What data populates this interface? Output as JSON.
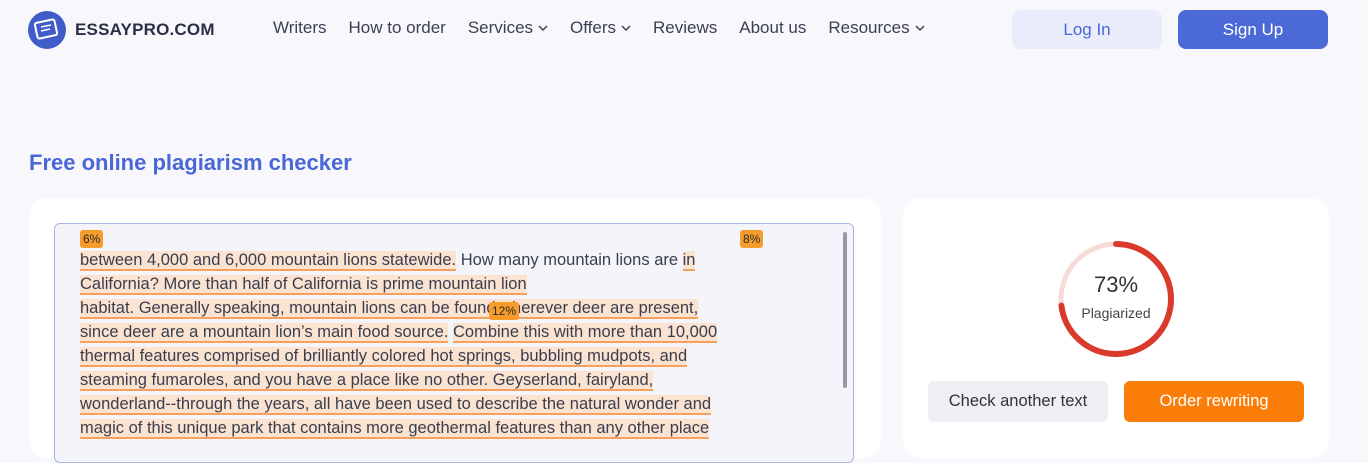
{
  "header": {
    "logo_text": "ESSAYPRO.COM",
    "nav": [
      {
        "label": "Writers",
        "dropdown": false
      },
      {
        "label": "How to order",
        "dropdown": false
      },
      {
        "label": "Services",
        "dropdown": true
      },
      {
        "label": "Offers",
        "dropdown": true
      },
      {
        "label": "Reviews",
        "dropdown": false
      },
      {
        "label": "About us",
        "dropdown": false
      },
      {
        "label": "Resources",
        "dropdown": true
      }
    ],
    "login_label": "Log In",
    "signup_label": "Sign Up"
  },
  "main": {
    "title": "Free online plagiarism checker",
    "checker": {
      "tags": [
        "6%",
        "8%",
        "12%"
      ],
      "lines": [
        [
          {
            "t": "between 4,000 and 6,000 mountain lions statewide.",
            "h": true
          },
          {
            "t": " How many mountain lions are ",
            "h": false
          },
          {
            "t": "in",
            "h": true
          }
        ],
        [
          {
            "t": "California? More than half of California is prime mountain lion",
            "h": true
          }
        ],
        [
          {
            "t": "habitat. Generally speaking, mountain lions can be found wherever deer are present,",
            "h": true
          }
        ],
        [
          {
            "t": "since deer are a mountain lion’s main food source.",
            "h": true
          },
          {
            "t": " ",
            "h": false
          },
          {
            "t": "Combine this with more than 10,000",
            "h": true
          }
        ],
        [
          {
            "t": "thermal features comprised of brilliantly colored hot springs, bubbling mudpots, and",
            "h": true
          }
        ],
        [
          {
            "t": "steaming fumaroles, and you have a place like no other. Geyserland, fairyland,",
            "h": true
          }
        ],
        [
          {
            "t": "wonderland--through the years, all have been used to describe the natural wonder and",
            "h": true
          }
        ],
        [
          {
            "t": "magic of this unique park that contains more geothermal features than any other place",
            "h": true
          }
        ]
      ]
    },
    "result": {
      "percent": 73,
      "percent_label": "73%",
      "label": "Plagiarized",
      "check_another_label": "Check another text",
      "order_rewriting_label": "Order rewriting"
    }
  },
  "colors": {
    "brand": "#4a67d6",
    "highlight": "#fbe3d2",
    "highlight_underline": "#f5a15c",
    "tag": "#f59c2a",
    "gauge": "#d93a2b",
    "gauge_track": "#f6dcd8",
    "order_button": "#fb7d09"
  }
}
